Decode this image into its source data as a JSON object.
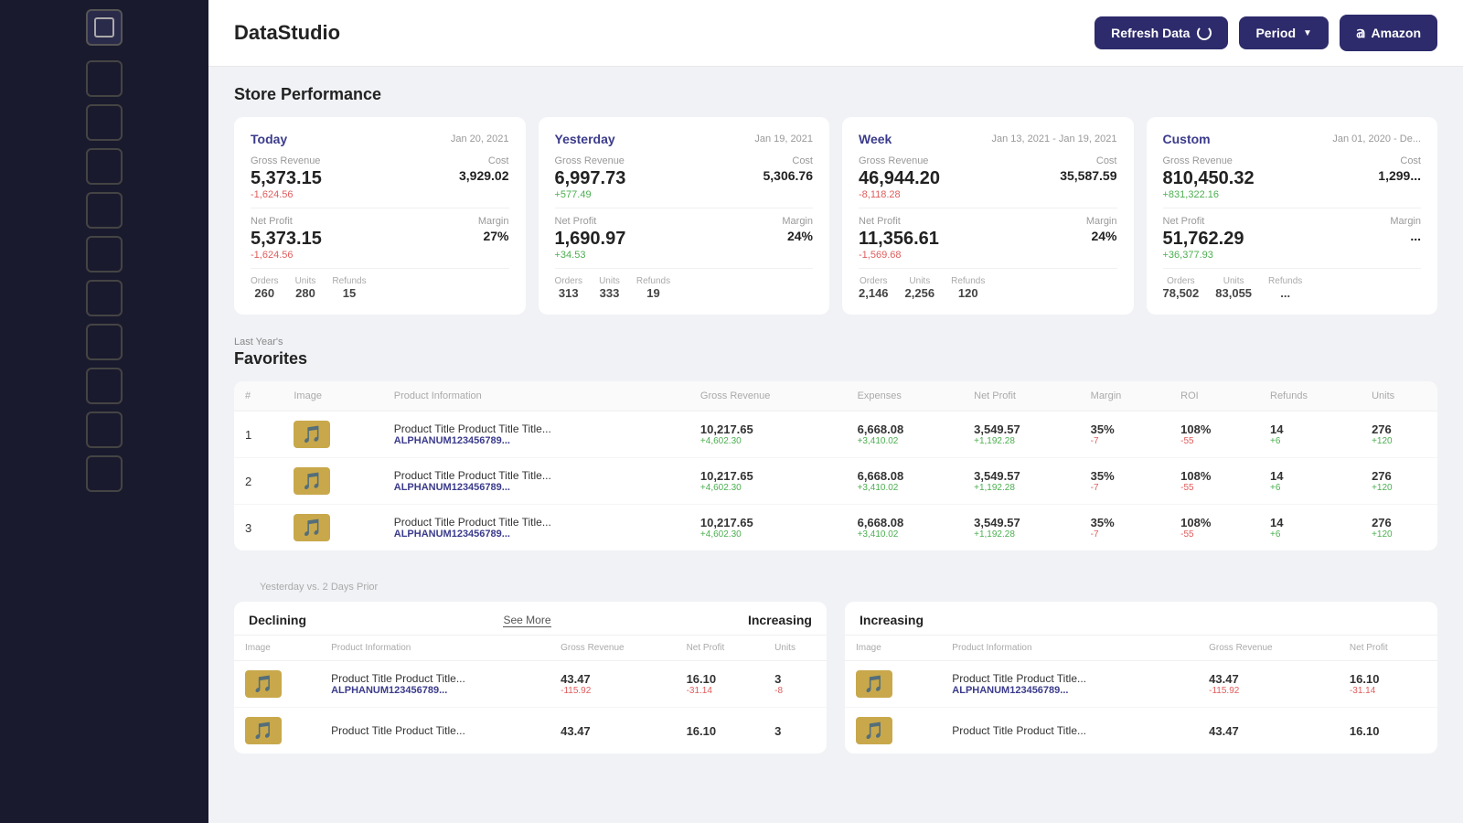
{
  "app": {
    "title": "DataStudio"
  },
  "header": {
    "refresh_label": "Refresh Data",
    "period_label": "Period",
    "amazon_label": "Amazon"
  },
  "store_performance": {
    "section_title": "Store Performance",
    "cards": [
      {
        "period": "Today",
        "date": "Jan 20, 2021",
        "gross_revenue_label": "Gross Revenue",
        "gross_revenue": "5,373.15",
        "gross_revenue_change": "-1,624.56",
        "cost_label": "Cost",
        "cost": "3,929.02",
        "net_profit_label": "Net Profit",
        "net_profit": "5,373.15",
        "net_profit_change": "-1,624.56",
        "margin_label": "Margin",
        "margin": "27%",
        "orders_label": "Orders",
        "orders": "260",
        "units_label": "Units",
        "units": "280",
        "refunds_label": "Refunds",
        "refunds": "15"
      },
      {
        "period": "Yesterday",
        "date": "Jan 19, 2021",
        "gross_revenue_label": "Gross Revenue",
        "gross_revenue": "6,997.73",
        "gross_revenue_change": "+577.49",
        "cost_label": "Cost",
        "cost": "5,306.76",
        "net_profit_label": "Net Profit",
        "net_profit": "1,690.97",
        "net_profit_change": "+34.53",
        "margin_label": "Margin",
        "margin": "24%",
        "orders_label": "Orders",
        "orders": "313",
        "units_label": "Units",
        "units": "333",
        "refunds_label": "Refunds",
        "refunds": "19"
      },
      {
        "period": "Week",
        "date": "Jan 13, 2021 - Jan 19, 2021",
        "gross_revenue_label": "Gross Revenue",
        "gross_revenue": "46,944.20",
        "gross_revenue_change": "-8,118.28",
        "cost_label": "Cost",
        "cost": "35,587.59",
        "net_profit_label": "Net Profit",
        "net_profit": "11,356.61",
        "net_profit_change": "-1,569.68",
        "margin_label": "Margin",
        "margin": "24%",
        "orders_label": "Orders",
        "orders": "2,146",
        "units_label": "Units",
        "units": "2,256",
        "refunds_label": "Refunds",
        "refunds": "120"
      },
      {
        "period": "Custom",
        "date": "Jan 01, 2020 - De...",
        "gross_revenue_label": "Gross Revenue",
        "gross_revenue": "810,450.32",
        "gross_revenue_change": "+831,322.16",
        "cost_label": "Cost",
        "cost": "1,299...",
        "net_profit_label": "Net Profit",
        "net_profit": "51,762.29",
        "net_profit_change": "+36,377.93",
        "margin_label": "Margin",
        "margin": "...",
        "orders_label": "Orders",
        "orders": "78,502",
        "units_label": "Units",
        "units": "83,055",
        "refunds_label": "Refunds",
        "refunds": "..."
      }
    ]
  },
  "favorites": {
    "section_label": "Last Year's",
    "section_title": "Favorites",
    "columns": [
      "#",
      "Image",
      "Product Information",
      "Gross Revenue",
      "Expenses",
      "Net Profit",
      "Margin",
      "ROI",
      "Refunds",
      "Units"
    ],
    "rows": [
      {
        "num": "1",
        "title": "Product Title Product Title Title...",
        "sku": "ALPHANUM123456789...",
        "gross_revenue": "10,217.65",
        "gross_revenue_change": "+4,602.30",
        "expenses": "6,668.08",
        "expenses_change": "+3,410.02",
        "net_profit": "3,549.57",
        "net_profit_change": "+1,192.28",
        "margin": "35%",
        "margin_change": "-7",
        "roi": "108%",
        "roi_change": "-55",
        "refunds": "14",
        "refunds_change": "+6",
        "units": "276",
        "units_change": "+120"
      },
      {
        "num": "2",
        "title": "Product Title Product Title Title...",
        "sku": "ALPHANUM123456789...",
        "gross_revenue": "10,217.65",
        "gross_revenue_change": "+4,602.30",
        "expenses": "6,668.08",
        "expenses_change": "+3,410.02",
        "net_profit": "3,549.57",
        "net_profit_change": "+1,192.28",
        "margin": "35%",
        "margin_change": "-7",
        "roi": "108%",
        "roi_change": "-55",
        "refunds": "14",
        "refunds_change": "+6",
        "units": "276",
        "units_change": "+120"
      },
      {
        "num": "3",
        "title": "Product Title Product Title Title...",
        "sku": "ALPHANUM123456789...",
        "gross_revenue": "10,217.65",
        "gross_revenue_change": "+4,602.30",
        "expenses": "6,668.08",
        "expenses_change": "+3,410.02",
        "net_profit": "3,549.57",
        "net_profit_change": "+1,192.28",
        "margin": "35%",
        "margin_change": "-7",
        "roi": "108%",
        "roi_change": "-55",
        "refunds": "14",
        "refunds_change": "+6",
        "units": "276",
        "units_change": "+120"
      }
    ]
  },
  "bottom": {
    "period_label": "Yesterday vs. 2 Days Prior",
    "declining": {
      "title": "Declining",
      "see_more": "See More",
      "columns": [
        "Image",
        "Product Information",
        "Gross Revenue",
        "Net Profit",
        "Units"
      ],
      "rows": [
        {
          "title": "Product Title Product Title...",
          "sku": "ALPHANUM123456789...",
          "gross_revenue": "43.47",
          "gross_revenue_change": "-115.92",
          "net_profit": "16.10",
          "net_profit_change": "-31.14",
          "units": "3",
          "units_change": "-8"
        },
        {
          "title": "Product Title Product Title...",
          "sku": "",
          "gross_revenue": "43.47",
          "gross_revenue_change": "",
          "net_profit": "16.10",
          "net_profit_change": "",
          "units": "3",
          "units_change": ""
        }
      ]
    },
    "increasing": {
      "title": "Increasing",
      "columns": [
        "Image",
        "Product Information",
        "Gross Revenue",
        "Net Profit"
      ],
      "rows": [
        {
          "title": "Product Title Product Title...",
          "sku": "ALPHANUM123456789...",
          "gross_revenue": "43.47",
          "gross_revenue_change": "-115.92",
          "net_profit": "16.10",
          "net_profit_change": "-31.14"
        },
        {
          "title": "Product Title Product Title...",
          "sku": "",
          "gross_revenue": "43.47",
          "gross_revenue_change": "",
          "net_profit": "16.10",
          "net_profit_change": ""
        }
      ]
    }
  },
  "sidebar": {
    "items": [
      {
        "label": "item-1"
      },
      {
        "label": "item-2"
      },
      {
        "label": "item-3"
      },
      {
        "label": "item-4"
      },
      {
        "label": "item-5"
      },
      {
        "label": "item-6"
      },
      {
        "label": "item-7"
      },
      {
        "label": "item-8"
      },
      {
        "label": "item-9"
      },
      {
        "label": "item-10"
      }
    ]
  }
}
